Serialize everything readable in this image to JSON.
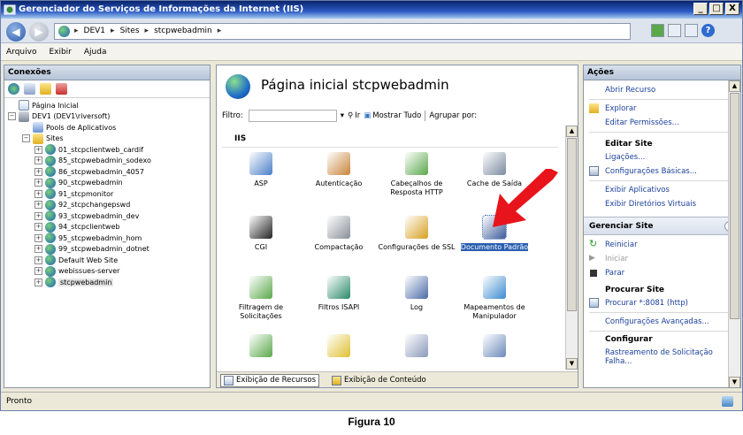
{
  "window": {
    "title": "Gerenciador do Serviços de Informações da Internet (IIS)",
    "buttons": [
      "_",
      "□",
      "X"
    ]
  },
  "address": {
    "crumbs": [
      "DEV1",
      "Sites",
      "stcpwebadmin"
    ],
    "separator": "▸"
  },
  "menu": {
    "items": [
      "Arquivo",
      "Exibir",
      "Ajuda"
    ]
  },
  "connections": {
    "header": "Conexões",
    "tree": [
      {
        "label": "Página Inicial",
        "icon": "home-page-icon"
      },
      {
        "label": "DEV1 (DEV1\\riversoft)",
        "icon": "server-icon",
        "expander": "−"
      },
      {
        "label": "Pools de Aplicativos",
        "icon": "app-pool-icon"
      },
      {
        "label": "Sites",
        "icon": "folder-icon",
        "expander": "−"
      },
      {
        "label": "01_stcpclientweb_cardif",
        "icon": "globe-icon",
        "expander": "+"
      },
      {
        "label": "85_stcpwebadmin_sodexo",
        "icon": "globe-icon",
        "expander": "+"
      },
      {
        "label": "86_stcpwebadmin_4057",
        "icon": "globe-icon",
        "expander": "+"
      },
      {
        "label": "90_stcpwebadmin",
        "icon": "globe-icon",
        "expander": "+"
      },
      {
        "label": "91_stcpmonitor",
        "icon": "globe-icon",
        "expander": "+"
      },
      {
        "label": "92_stcpchangepswd",
        "icon": "globe-icon",
        "expander": "+"
      },
      {
        "label": "93_stcpwebadmin_dev",
        "icon": "globe-icon",
        "expander": "+"
      },
      {
        "label": "94_stcpclientweb",
        "icon": "globe-icon",
        "expander": "+"
      },
      {
        "label": "95_stcpwebadmin_hom",
        "icon": "globe-icon",
        "expander": "+"
      },
      {
        "label": "99_stcpwebadmin_dotnet",
        "icon": "globe-icon",
        "expander": "+"
      },
      {
        "label": "Default Web Site",
        "icon": "globe-icon",
        "expander": "+"
      },
      {
        "label": "webissues-server",
        "icon": "globe-icon",
        "expander": "+"
      },
      {
        "label": "stcpwebadmin",
        "icon": "globe-icon",
        "expander": "+",
        "selected": true
      }
    ]
  },
  "center": {
    "title": "Página inicial stcpwebadmin",
    "filter_label": "Filtro:",
    "go_label": "Ir",
    "show_all_label": "Mostrar Tudo",
    "group_by_label": "Agrupar por:",
    "section": "IIS",
    "features": [
      {
        "label": "ASP",
        "icon": "asp-icon",
        "color": "#4a7fc8"
      },
      {
        "label": "Autenticação",
        "icon": "authentication-icon",
        "color": "#c8843a"
      },
      {
        "label": "Cabeçalhos de Resposta HTTP",
        "icon": "http-headers-icon",
        "color": "#5aa84a"
      },
      {
        "label": "Cache de Saída",
        "icon": "output-cache-icon",
        "color": "#7a8aa0"
      },
      {
        "label": "CGI",
        "icon": "cgi-icon",
        "color": "#222222"
      },
      {
        "label": "Compactação",
        "icon": "compression-icon",
        "color": "#8a9098"
      },
      {
        "label": "Configurações de SSL",
        "icon": "ssl-lock-icon",
        "color": "#d8a020"
      },
      {
        "label": "Documento Padrão",
        "icon": "default-document-icon",
        "color": "#3a5a9a",
        "selected": true
      },
      {
        "label": "Filtragem de Solicitações",
        "icon": "request-filtering-icon",
        "color": "#5aa84a"
      },
      {
        "label": "Filtros ISAPI",
        "icon": "isapi-filters-icon",
        "color": "#2a8a6a"
      },
      {
        "label": "Log",
        "icon": "log-icon",
        "color": "#4a6aa8"
      },
      {
        "label": "Mapeamentos de Manipulador",
        "icon": "handler-mappings-icon",
        "color": "#3a8ad0"
      },
      {
        "label": "",
        "icon": "modules-icon",
        "color": "#5aa84a"
      },
      {
        "label": "",
        "icon": "error-pages-icon",
        "color": "#e0c030"
      },
      {
        "label": "",
        "icon": "directory-browsing-icon",
        "color": "#8a9aba"
      },
      {
        "label": "",
        "icon": "mime-types-icon",
        "color": "#6a8aba"
      }
    ],
    "tabs": [
      "Exibição de Recursos",
      "Exibição de Conteúdo"
    ]
  },
  "actions": {
    "header": "Ações",
    "top": [
      {
        "label": "Abrir Recurso",
        "icon": ""
      },
      {
        "label": "Explorar",
        "icon": "explore-folder-icon"
      },
      {
        "label": "Editar Permissões...",
        "icon": ""
      }
    ],
    "edit_site": {
      "title": "Editar Site",
      "items": [
        {
          "label": "Ligações...",
          "icon": ""
        },
        {
          "label": "Configurações Básicas...",
          "icon": "basic-settings-icon"
        },
        {
          "label": "Exibir Aplicativos",
          "icon": ""
        },
        {
          "label": "Exibir Diretórios Virtuais",
          "icon": ""
        }
      ]
    },
    "manage_site": {
      "title": "Gerenciar Site",
      "collapse": "⌃",
      "items": [
        {
          "label": "Reiniciar",
          "icon": "restart-icon",
          "enabled": true
        },
        {
          "label": "Iniciar",
          "icon": "start-icon",
          "enabled": false
        },
        {
          "label": "Parar",
          "icon": "stop-icon",
          "enabled": true
        }
      ],
      "browse_title": "Procurar Site",
      "browse_item": "Procurar *:8081 (http)",
      "advanced": "Configurações Avançadas...",
      "configure_title": "Configurar",
      "configure_item": "Rastreamento de Solicitação Falha..."
    }
  },
  "status": {
    "text": "Pronto"
  },
  "caption": "Figura 10",
  "colors": {
    "titlebar": "#0a246a",
    "link": "#1a3f9a",
    "selection": "#2a5fb0",
    "annotation_arrow": "#e8141c"
  }
}
